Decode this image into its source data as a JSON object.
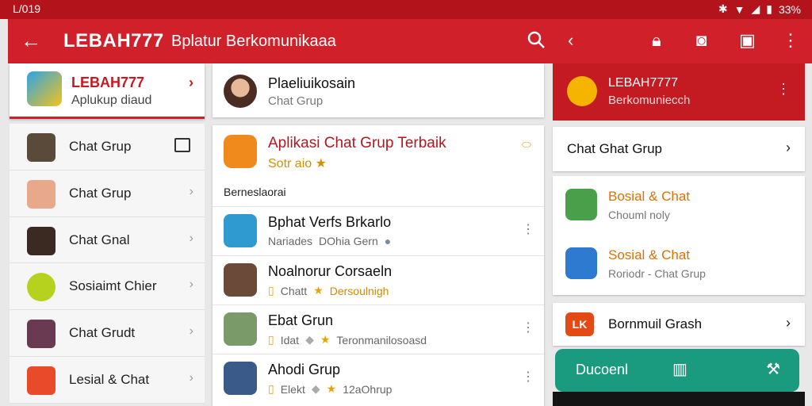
{
  "status_bar": {
    "time": "L/019",
    "battery": "33%"
  },
  "app_bar": {
    "brand": "LEBAH777",
    "subtitle": "Bplatur Berkomunikaaa"
  },
  "profile": {
    "name": "LEBAH777",
    "desc": "Aplukup diaud"
  },
  "left_list": [
    {
      "label": "Chat Grup"
    },
    {
      "label": "Chat Grup"
    },
    {
      "label": "Chat Gnal"
    },
    {
      "label": "Sosiaimt Chier"
    },
    {
      "label": "Chat Grudt"
    },
    {
      "label": "Lesial & Chat"
    }
  ],
  "mid_top": {
    "name": "Plaeliuikosain",
    "sub": "Chat Grup"
  },
  "featured": {
    "title": "Aplikasi Chat Grup Terbaik",
    "rating": "Sotr aio"
  },
  "section_label": "Berneslaorai",
  "mid_list": [
    {
      "name": "Bphat Verfs Brkarlo",
      "meta1": "Nariades",
      "meta2": "DOhia Gern",
      "star": false
    },
    {
      "name": "Noalnorur Corsaeln",
      "meta1": "Chatt",
      "meta2": "Dersoulnigh",
      "star": true
    },
    {
      "name": "Ebat Grun",
      "meta1": "Idat",
      "meta2": "Teronmanilosoasd",
      "star": true
    },
    {
      "name": "Ahodi Grup",
      "meta1": "Elekt",
      "meta2": "12aOhrup",
      "star": true
    }
  ],
  "right_panel": {
    "head_name": "LEBAH7777",
    "head_sub": "Berkomuniecch",
    "row1": "Chat Ghat Grup",
    "card": [
      {
        "title": "Bosial & Chat",
        "sub": "Chouml noly"
      },
      {
        "title": "Sosial & Chat",
        "sub": "Roriodr - Chat Grup"
      }
    ],
    "row2_badge": "LK",
    "row2_label": "Bornmuil Grash",
    "fab_label": "Ducoenl"
  },
  "colors": {
    "primary": "#d0202a",
    "accent_green": "#1a9b80",
    "warning_orange": "#e07000"
  }
}
